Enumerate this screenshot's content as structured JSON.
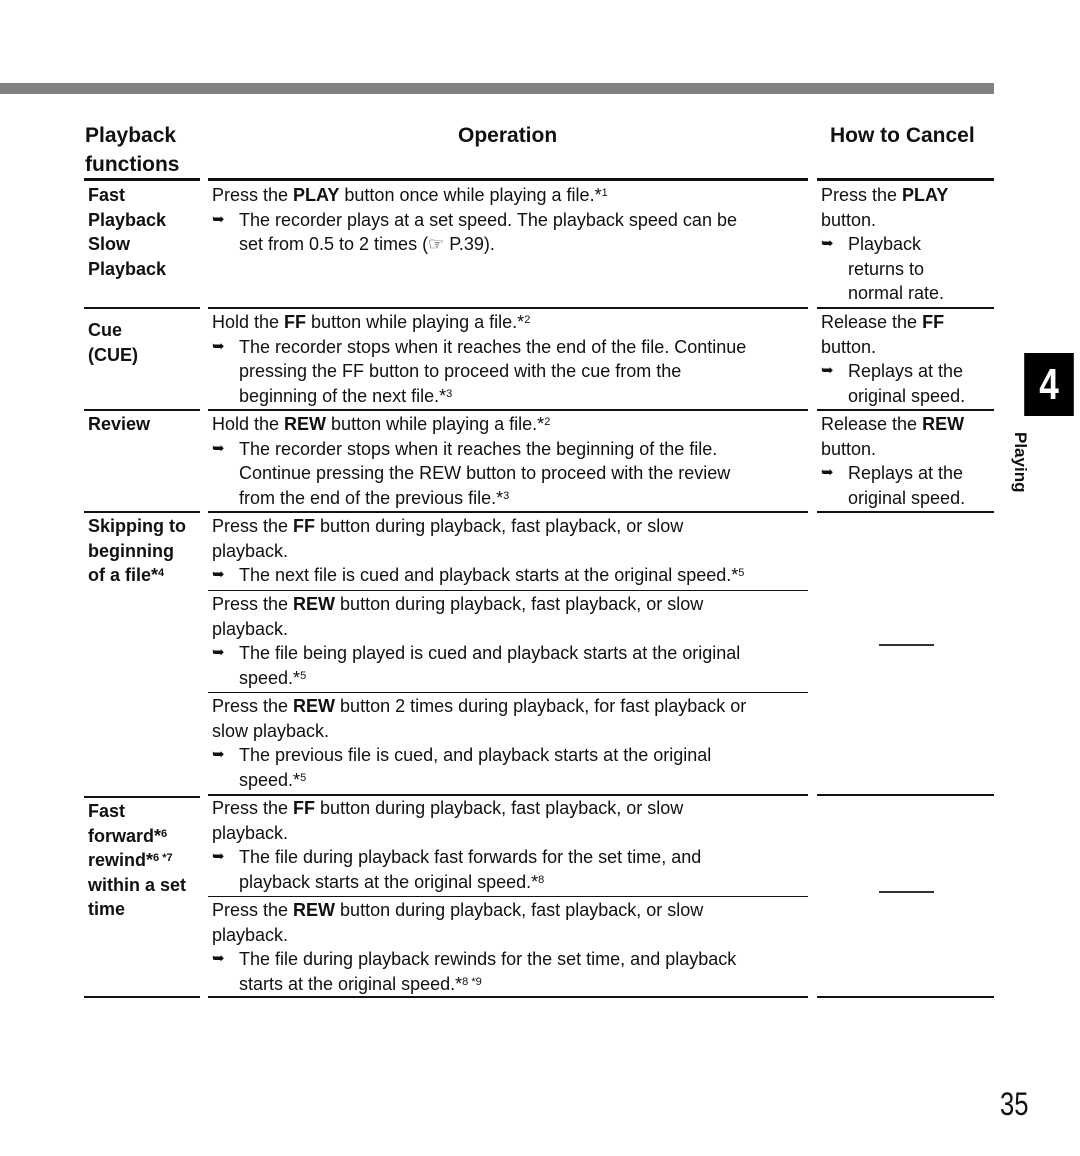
{
  "header": {
    "col1_line1": "Playback",
    "col1_line2": "functions",
    "col2": "Operation",
    "col3": "How to Cancel"
  },
  "side_tab": {
    "chapter": "4",
    "label": "Playing"
  },
  "page_number": "35",
  "arrow_glyph": "➥",
  "rows": {
    "fast": {
      "function_lines": [
        "Fast",
        "Playback",
        "Slow",
        "Playback"
      ],
      "op_pre": "Press the ",
      "op_bold": "PLAY",
      "op_post": " button once while playing a file.*",
      "op_sup": "1",
      "res_line1": "The recorder plays at a set speed.  The playback speed can be",
      "res_line2": "set from 0.5 to 2 times (☞ P.39).",
      "cancel_pre": "Press the ",
      "cancel_bold": "PLAY",
      "cancel_line2": "button.",
      "cancel_res": [
        "Playback",
        "returns to",
        "normal rate."
      ]
    },
    "cue": {
      "function_lines": [
        "Cue",
        "(CUE)"
      ],
      "op_pre": "Hold the ",
      "op_bold": "FF",
      "op_post": " button while playing a file.*",
      "op_sup": "2",
      "res_line1": "The recorder stops when it reaches the end of the file. Continue",
      "res_line2": "pressing the FF button to proceed with the cue from the",
      "res_line3": "beginning of the next file.*",
      "res_sup": "3",
      "cancel_pre": "Release the ",
      "cancel_bold": "FF",
      "cancel_line2": "button.",
      "cancel_res": [
        "Replays at the",
        "original speed."
      ]
    },
    "review": {
      "function_lines": [
        "Review"
      ],
      "op_pre": "Hold the ",
      "op_bold": "REW",
      "op_post": " button while playing a file.*",
      "op_sup": "2",
      "res_line1": "The recorder stops when it reaches the beginning  of the file.",
      "res_line2": "Continue pressing the REW button to proceed with the review",
      "res_line3": "from the end of the previous file.*",
      "res_sup": "3",
      "cancel_pre": "Release the ",
      "cancel_bold": "REW",
      "cancel_line2": "button.",
      "cancel_res": [
        "Replays at the",
        "original speed."
      ]
    },
    "skip": {
      "function_lines": [
        "Skipping to",
        "beginning",
        "of a file*"
      ],
      "function_sup": "4",
      "sub": [
        {
          "op_pre": "Press the ",
          "op_bold": "FF",
          "op_post": " button during playback, fast playback, or slow",
          "op_line2": "playback.",
          "res_line1": "The next file is cued and playback starts at the original speed.*",
          "res_sup": "5"
        },
        {
          "op_pre": "Press the ",
          "op_bold": "REW",
          "op_post": " button during playback, fast playback, or slow",
          "op_line2": "playback.",
          "res_line1": "The file being played is cued and playback starts at the original",
          "res_line2": "speed.*",
          "res_sup": "5"
        },
        {
          "op_pre": "Press the ",
          "op_bold": "REW",
          "op_post": " button 2 times during playback, for fast playback or",
          "op_line2": "slow playback.",
          "res_line1": "The previous file is cued, and playback starts at the original",
          "res_line2": "speed.*",
          "res_sup": "5"
        }
      ],
      "cancel": "—"
    },
    "ffrew": {
      "f1": "Fast",
      "f2": "forward*",
      "f2_sup": "6",
      "f3": "rewind*",
      "f3_sup": "6 *7",
      "f4": "within a set",
      "f5": "time",
      "sub": [
        {
          "op_pre": "Press the ",
          "op_bold": "FF",
          "op_post": " button during playback, fast playback, or slow",
          "op_line2": "playback.",
          "res_line1": "The file during playback fast forwards for the set time, and",
          "res_line2": "playback starts at the original speed.*",
          "res_sup": "8"
        },
        {
          "op_pre": "Press the ",
          "op_bold": "REW",
          "op_post": " button during playback, fast playback, or slow",
          "op_line2": "playback.",
          "res_line1": "The file during playback rewinds for the set time, and playback",
          "res_line2": "starts at the original speed.*",
          "res_sup": "8 *9"
        }
      ],
      "cancel": "—"
    }
  }
}
